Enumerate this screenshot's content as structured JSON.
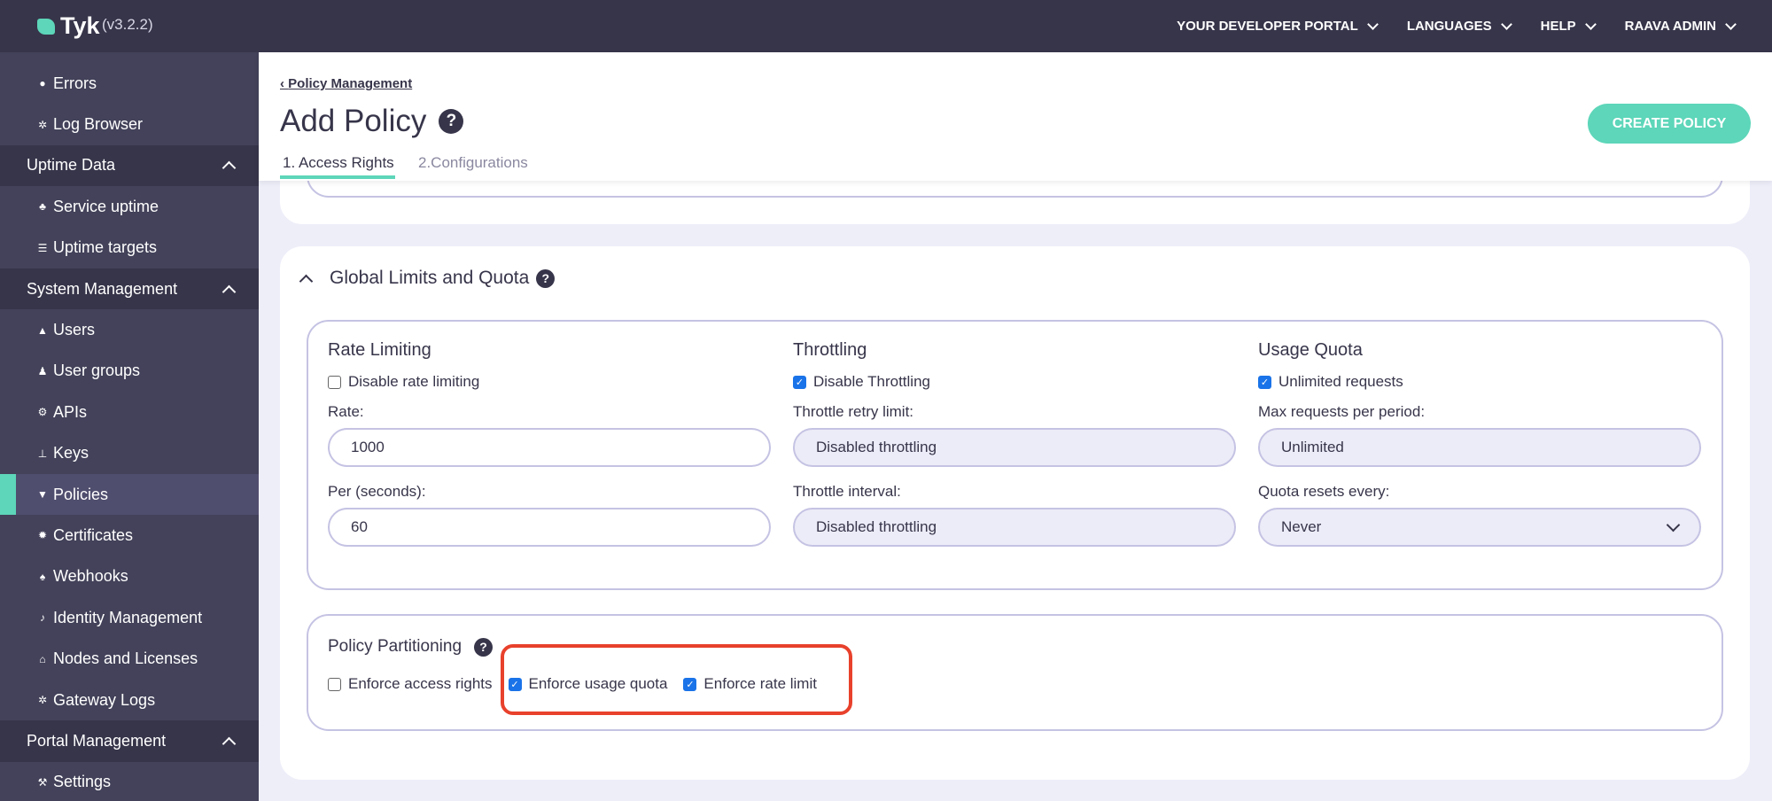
{
  "header": {
    "brand": "Tyk",
    "version": "(v3.2.2)",
    "nav": [
      "YOUR DEVELOPER PORTAL",
      "LANGUAGES",
      "HELP",
      "RAAVA ADMIN"
    ]
  },
  "sidebar": [
    {
      "type": "item",
      "label": "Errors",
      "icon": "●"
    },
    {
      "type": "item",
      "label": "Log Browser",
      "icon": "✲"
    },
    {
      "type": "section",
      "label": "Uptime Data"
    },
    {
      "type": "item",
      "label": "Service uptime",
      "icon": "♣"
    },
    {
      "type": "item",
      "label": "Uptime targets",
      "icon": "☰"
    },
    {
      "type": "section",
      "label": "System Management"
    },
    {
      "type": "item",
      "label": "Users",
      "icon": "▲"
    },
    {
      "type": "item",
      "label": "User groups",
      "icon": "♟"
    },
    {
      "type": "item",
      "label": "APIs",
      "icon": "⚙"
    },
    {
      "type": "item",
      "label": "Keys",
      "icon": "⊥"
    },
    {
      "type": "item",
      "label": "Policies",
      "icon": "▼",
      "active": true
    },
    {
      "type": "item",
      "label": "Certificates",
      "icon": "✹"
    },
    {
      "type": "item",
      "label": "Webhooks",
      "icon": "♠"
    },
    {
      "type": "item",
      "label": "Identity Management",
      "icon": "♪"
    },
    {
      "type": "item",
      "label": "Nodes and Licenses",
      "icon": "⌂"
    },
    {
      "type": "item",
      "label": "Gateway Logs",
      "icon": "✲"
    },
    {
      "type": "section",
      "label": "Portal Management"
    },
    {
      "type": "item",
      "label": "Settings",
      "icon": "⚒"
    }
  ],
  "page": {
    "breadcrumb": "Policy Management",
    "title": "Add Policy",
    "create_button": "CREATE POLICY",
    "tabs": [
      "1. Access Rights",
      "2.Configurations"
    ]
  },
  "global": {
    "title": "Global Limits and Quota",
    "rate": {
      "heading": "Rate Limiting",
      "checkbox": "Disable rate limiting",
      "checked": false,
      "rate_label": "Rate:",
      "rate_value": "1000",
      "per_label": "Per (seconds):",
      "per_value": "60"
    },
    "throttle": {
      "heading": "Throttling",
      "checkbox": "Disable Throttling",
      "checked": true,
      "retry_label": "Throttle retry limit:",
      "retry_value": "Disabled throttling",
      "interval_label": "Throttle interval:",
      "interval_value": "Disabled throttling"
    },
    "quota": {
      "heading": "Usage Quota",
      "checkbox": "Unlimited requests",
      "checked": true,
      "max_label": "Max requests per period:",
      "max_value": "Unlimited",
      "reset_label": "Quota resets every:",
      "reset_value": "Never"
    }
  },
  "partitioning": {
    "title": "Policy Partitioning",
    "options": [
      {
        "label": "Enforce access rights",
        "checked": false
      },
      {
        "label": "Enforce usage quota",
        "checked": true
      },
      {
        "label": "Enforce rate limit",
        "checked": true
      }
    ]
  },
  "colors": {
    "accent": "#5dd6b9",
    "header": "#37354a",
    "sidebar": "#43425a",
    "highlight": "#e8412c",
    "checkbox": "#1a73e8"
  }
}
